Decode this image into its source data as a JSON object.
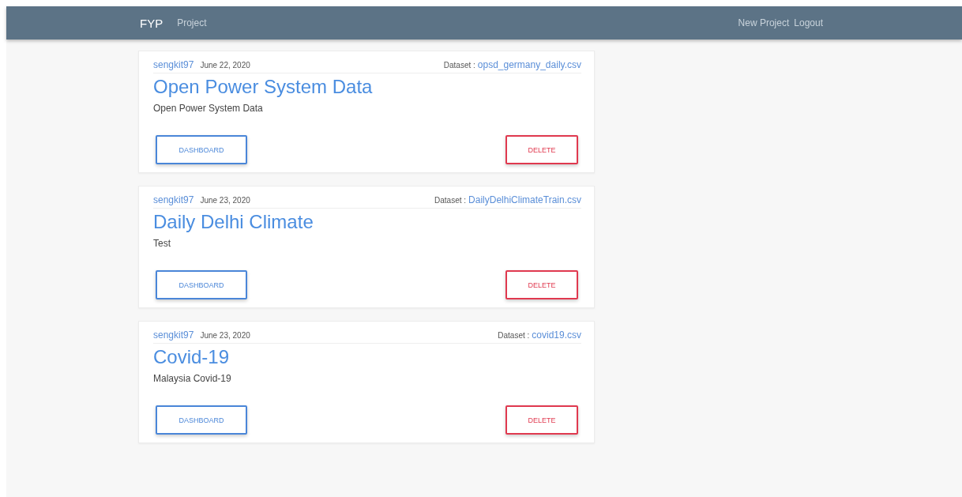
{
  "navbar": {
    "brand": "FYP",
    "links": [
      "Project"
    ],
    "right_links": [
      "New Project",
      "Logout"
    ]
  },
  "projects": [
    {
      "author": "sengkit97",
      "date": "June 22, 2020",
      "dataset_label": "Dataset :",
      "dataset": "opsd_germany_daily.csv",
      "title": "Open Power System Data",
      "description": "Open Power System Data",
      "dashboard_button": "DASHBOARD",
      "delete_button": "DELETE"
    },
    {
      "author": "sengkit97",
      "date": "June 23, 2020",
      "dataset_label": "Dataset :",
      "dataset": "DailyDelhiClimateTrain.csv",
      "title": "Daily Delhi Climate",
      "description": "Test",
      "dashboard_button": "DASHBOARD",
      "delete_button": "DELETE"
    },
    {
      "author": "sengkit97",
      "date": "June 23, 2020",
      "dataset_label": "Dataset :",
      "dataset": "covid19.csv",
      "title": "Covid-19",
      "description": "Malaysia Covid-19",
      "dashboard_button": "DASHBOARD",
      "delete_button": "DELETE"
    }
  ]
}
